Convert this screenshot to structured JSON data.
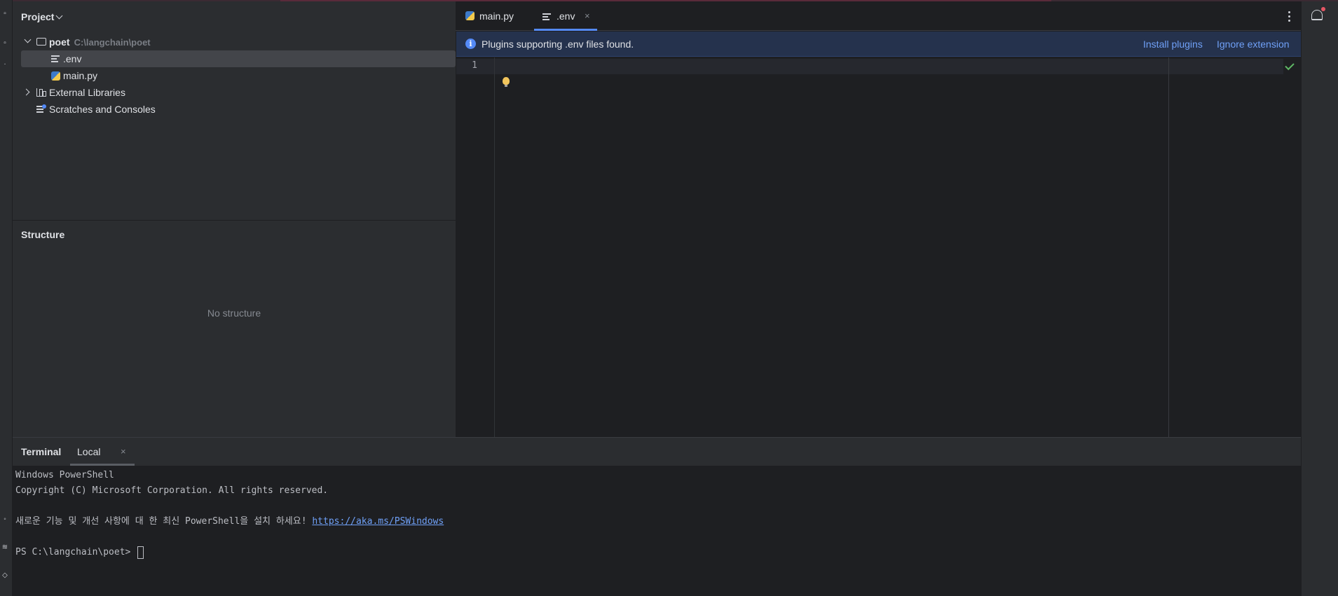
{
  "project": {
    "title": "Project",
    "tree": [
      {
        "label": "poet",
        "hint": "C:\\langchain\\poet"
      },
      {
        "label": ".env"
      },
      {
        "label": "main.py"
      },
      {
        "label": "External Libraries"
      },
      {
        "label": "Scratches and Consoles"
      }
    ]
  },
  "structure": {
    "title": "Structure",
    "empty_text": "No structure"
  },
  "editor": {
    "tabs": [
      {
        "label": "main.py"
      },
      {
        "label": ".env",
        "close": "×"
      }
    ],
    "banner": {
      "info": "i",
      "message": "Plugins supporting .env files found.",
      "install": "Install plugins",
      "ignore": "Ignore extension"
    },
    "line_number": "1"
  },
  "terminal": {
    "title": "Terminal",
    "tab_label": "Local",
    "tab_close": "×",
    "lines": [
      "Windows PowerShell",
      "Copyright (C) Microsoft Corporation. All rights reserved.",
      "",
      "새로운 기능 및 개선 사항에 대 한 최신 PowerShell을 설치 하세요! ",
      "",
      "PS C:\\langchain\\poet> "
    ],
    "link": "https://aka.ms/PSWindows"
  },
  "colors": {
    "accent": "#548af7",
    "banner_bg": "#25324d",
    "panel_bg": "#2b2d30",
    "editor_bg": "#1e1f22"
  },
  "icons": [
    "folder-icon",
    "env-file-icon",
    "python-file-icon",
    "library-icon",
    "scratches-icon",
    "info-icon",
    "lightbulb-icon",
    "check-icon",
    "bell-icon",
    "more-options-icon"
  ]
}
